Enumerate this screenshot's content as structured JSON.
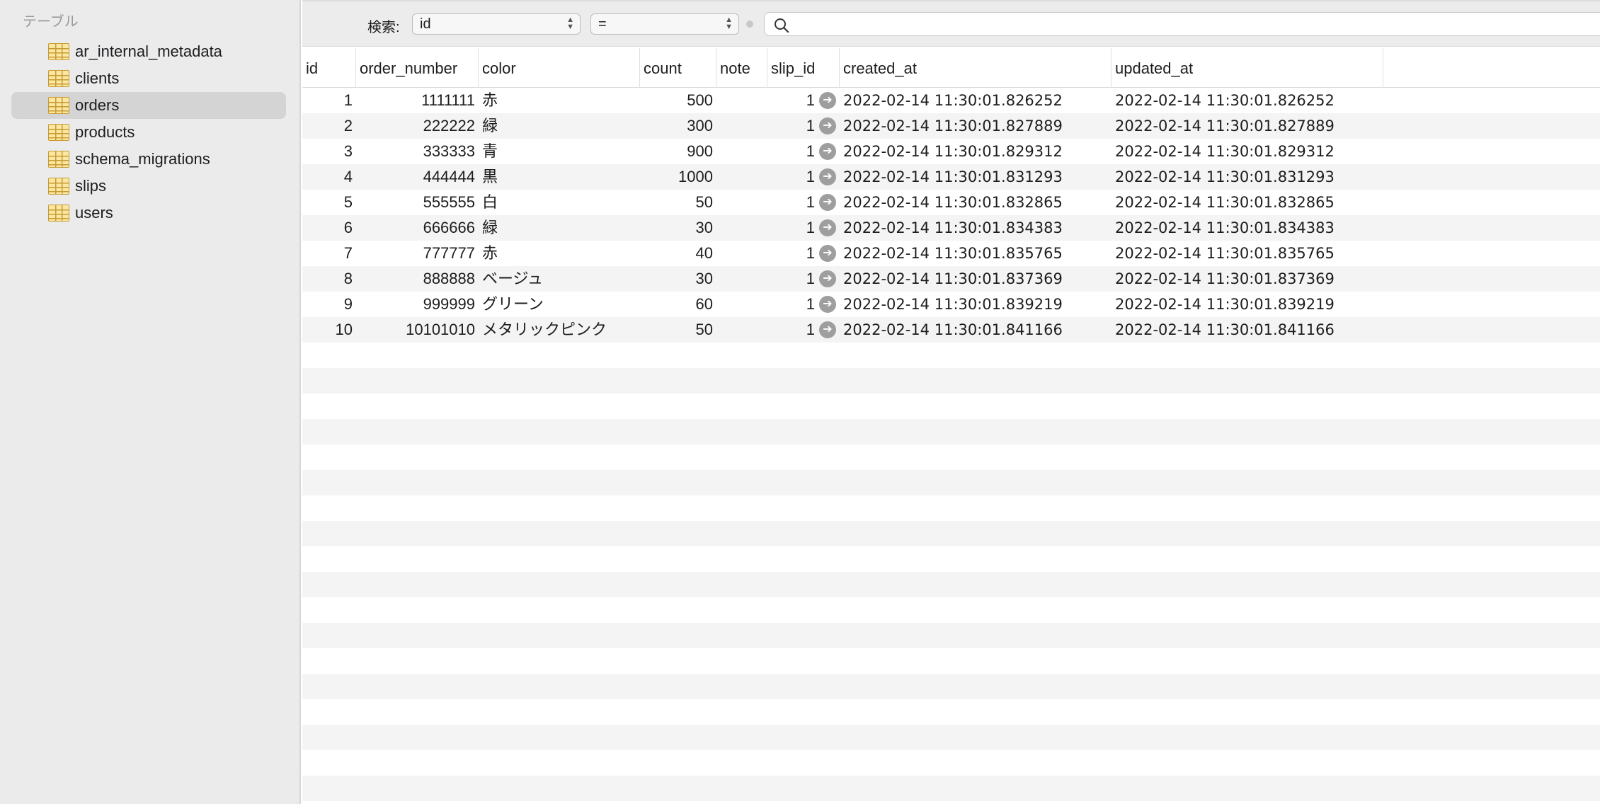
{
  "sidebar": {
    "title": "テーブル",
    "tables": [
      {
        "name": "ar_internal_metadata"
      },
      {
        "name": "clients"
      },
      {
        "name": "orders"
      },
      {
        "name": "products"
      },
      {
        "name": "schema_migrations"
      },
      {
        "name": "slips"
      },
      {
        "name": "users"
      }
    ],
    "selected": "orders"
  },
  "search": {
    "label": "検索:",
    "field": "id",
    "operator": "=",
    "query": ""
  },
  "columns": [
    "id",
    "order_number",
    "color",
    "count",
    "note",
    "slip_id",
    "created_at",
    "updated_at"
  ],
  "rows": [
    {
      "id": "1",
      "order_number": "1111111",
      "color": "赤",
      "count": "500",
      "note": "",
      "slip_id": "1",
      "created_at": "2022-02-14 11:30:01.826252",
      "updated_at": "2022-02-14 11:30:01.826252"
    },
    {
      "id": "2",
      "order_number": "222222",
      "color": "緑",
      "count": "300",
      "note": "",
      "slip_id": "1",
      "created_at": "2022-02-14 11:30:01.827889",
      "updated_at": "2022-02-14 11:30:01.827889"
    },
    {
      "id": "3",
      "order_number": "333333",
      "color": " 青",
      "count": "900",
      "note": "",
      "slip_id": "1",
      "created_at": "2022-02-14 11:30:01.829312",
      "updated_at": "2022-02-14 11:30:01.829312"
    },
    {
      "id": "4",
      "order_number": "444444",
      "color": "黒",
      "count": "1000",
      "note": "",
      "slip_id": "1",
      "created_at": "2022-02-14 11:30:01.831293",
      "updated_at": "2022-02-14 11:30:01.831293"
    },
    {
      "id": "5",
      "order_number": "555555",
      "color": "白",
      "count": "50",
      "note": "",
      "slip_id": "1",
      "created_at": "2022-02-14 11:30:01.832865",
      "updated_at": "2022-02-14 11:30:01.832865"
    },
    {
      "id": "6",
      "order_number": "666666",
      "color": "緑",
      "count": "30",
      "note": "",
      "slip_id": "1",
      "created_at": "2022-02-14 11:30:01.834383",
      "updated_at": "2022-02-14 11:30:01.834383"
    },
    {
      "id": "7",
      "order_number": "777777",
      "color": "赤",
      "count": "40",
      "note": "",
      "slip_id": "1",
      "created_at": "2022-02-14 11:30:01.835765",
      "updated_at": "2022-02-14 11:30:01.835765"
    },
    {
      "id": "8",
      "order_number": "888888",
      "color": "ベージュ",
      "count": "30",
      "note": "",
      "slip_id": "1",
      "created_at": "2022-02-14 11:30:01.837369",
      "updated_at": "2022-02-14 11:30:01.837369"
    },
    {
      "id": "9",
      "order_number": "999999",
      "color": "グリーン",
      "count": "60",
      "note": "",
      "slip_id": "1",
      "created_at": "2022-02-14 11:30:01.839219",
      "updated_at": "2022-02-14 11:30:01.839219"
    },
    {
      "id": "10",
      "order_number": "10101010",
      "color": "メタリックピンク",
      "count": "50",
      "note": "",
      "slip_id": "1",
      "created_at": "2022-02-14 11:30:01.841166",
      "updated_at": "2022-02-14 11:30:01.841166"
    }
  ],
  "icons": {
    "table": "table-icon",
    "search": "magnifier-icon",
    "foreign_key": "arrow-right-circle-icon"
  },
  "colors": {
    "sidebar_bg": "#ebebeb",
    "selected_row": "#d4d4d4",
    "table_icon": "#c79b33",
    "alt_row": "#f4f4f4"
  }
}
